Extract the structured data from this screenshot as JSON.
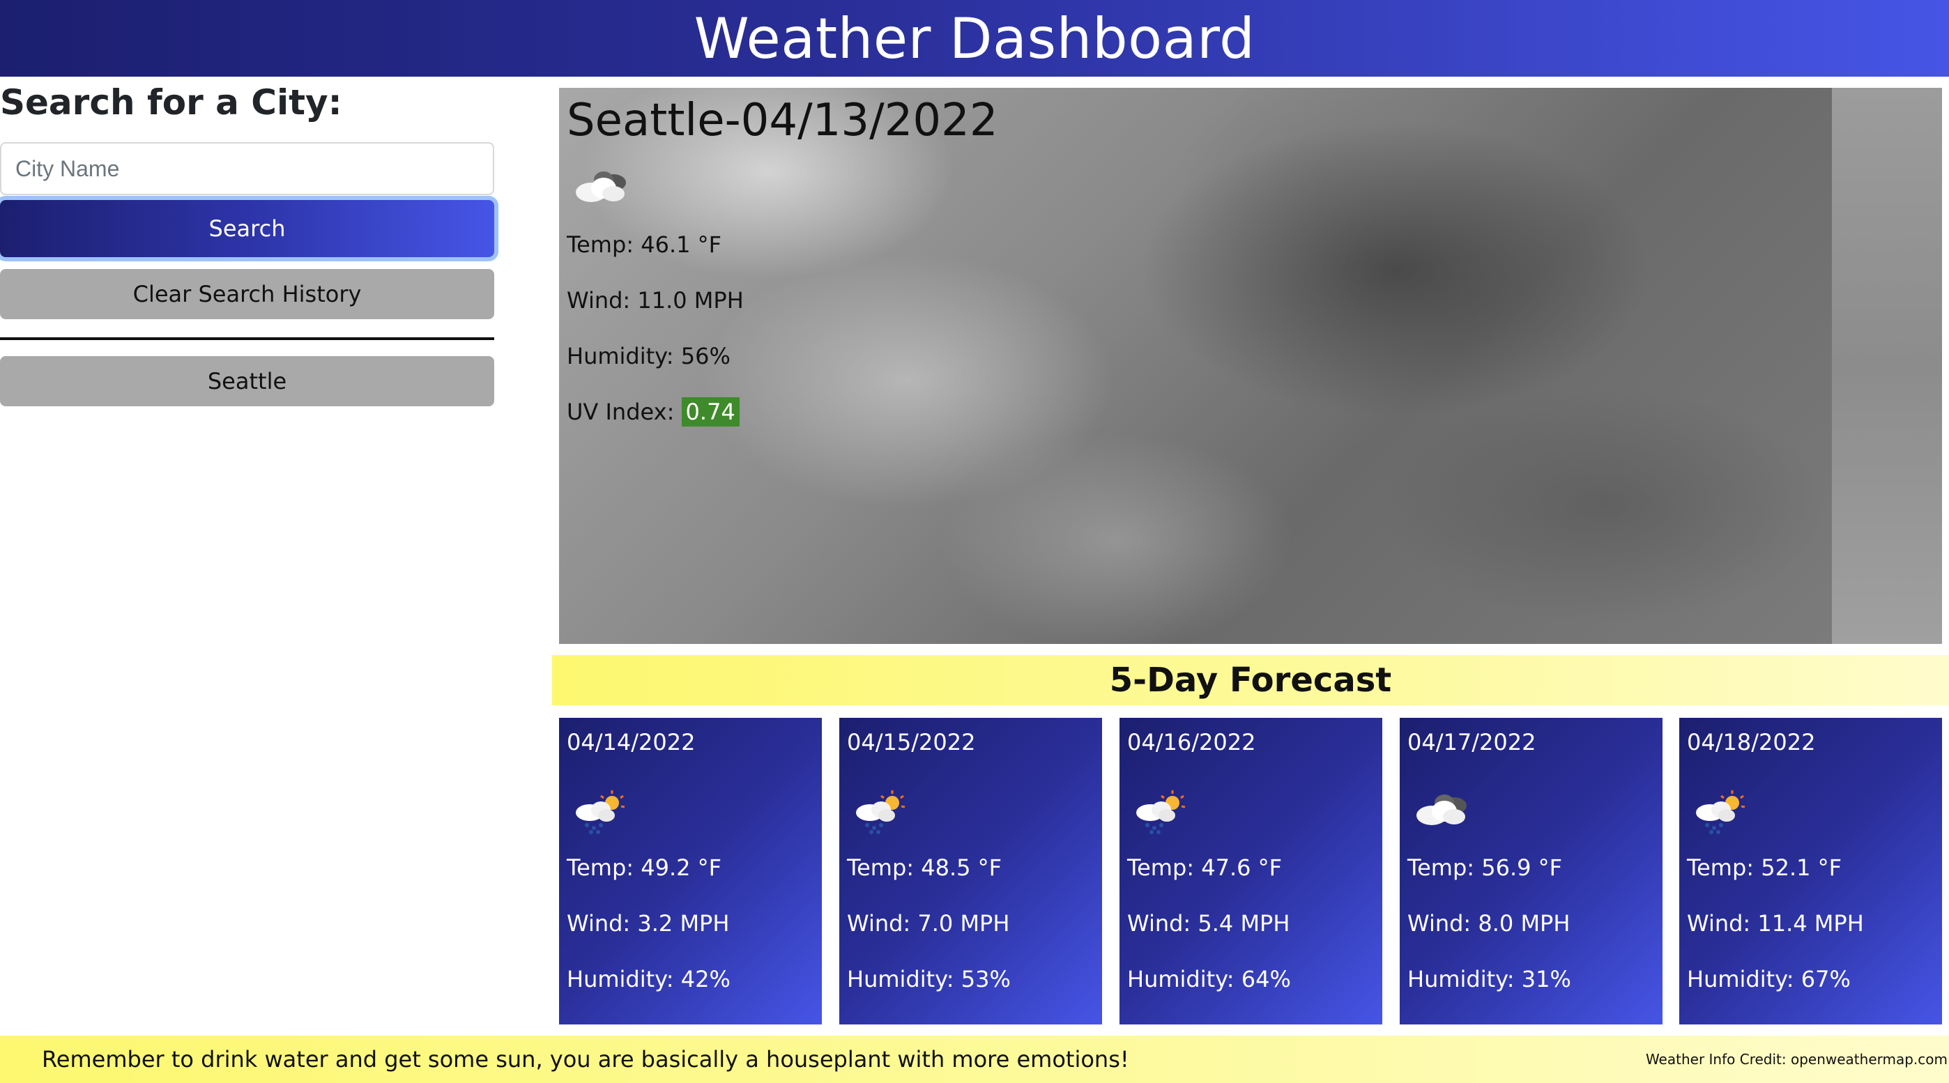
{
  "header": {
    "title": "Weather Dashboard"
  },
  "search": {
    "title": "Search for a City:",
    "placeholder": "City Name",
    "value": "",
    "search_label": "Search",
    "clear_label": "Clear Search History",
    "history": [
      "Seattle"
    ]
  },
  "current": {
    "heading": "Seattle-04/13/2022",
    "icon": "cloudy-icon",
    "temp": "Temp: 46.1 °F",
    "wind": "Wind: 11.0 MPH",
    "humidity": "Humidity: 56%",
    "uv_label": "UV Index: ",
    "uv_value": "0.74",
    "uv_color": "#3f8a2a"
  },
  "forecast": {
    "title": "5-Day Forecast",
    "days": [
      {
        "date": "04/14/2022",
        "icon": "rain-sun-icon",
        "temp": "Temp: 49.2 °F",
        "wind": "Wind: 3.2 MPH",
        "humidity": "Humidity: 42%"
      },
      {
        "date": "04/15/2022",
        "icon": "rain-sun-icon",
        "temp": "Temp: 48.5 °F",
        "wind": "Wind: 7.0 MPH",
        "humidity": "Humidity: 53%"
      },
      {
        "date": "04/16/2022",
        "icon": "rain-sun-icon",
        "temp": "Temp: 47.6 °F",
        "wind": "Wind: 5.4 MPH",
        "humidity": "Humidity: 64%"
      },
      {
        "date": "04/17/2022",
        "icon": "cloudy-icon",
        "temp": "Temp: 56.9 °F",
        "wind": "Wind: 8.0 MPH",
        "humidity": "Humidity: 31%"
      },
      {
        "date": "04/18/2022",
        "icon": "rain-sun-icon",
        "temp": "Temp: 52.1 °F",
        "wind": "Wind: 11.4 MPH",
        "humidity": "Humidity: 67%"
      }
    ]
  },
  "footer": {
    "message": "Remember to drink water and get some sun, you are basically a houseplant with more emotions!",
    "credit": "Weather Info Credit: openweathermap.com"
  }
}
